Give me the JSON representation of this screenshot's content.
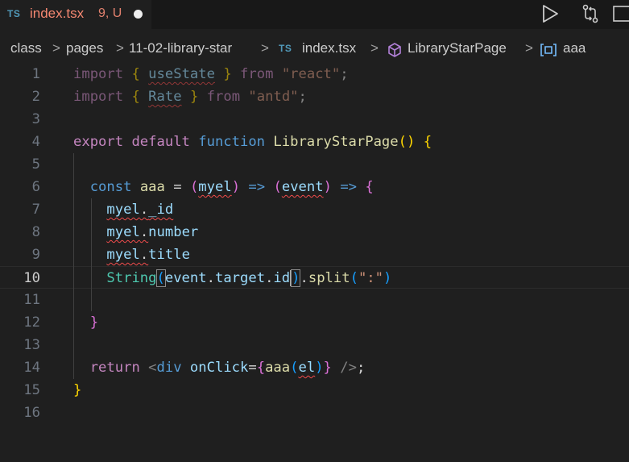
{
  "tab": {
    "lang_badge": "TS",
    "filename": "index.tsx",
    "status": "9, U"
  },
  "actions": {
    "run": "play-icon",
    "compare": "compare-changes-icon"
  },
  "breadcrumb": {
    "items": [
      "class",
      "pages",
      "11-02-library-star",
      "index.tsx",
      "LibraryStarPage",
      "aaa"
    ],
    "file_badge": "TS",
    "separator": ">"
  },
  "editor": {
    "current_line": 10,
    "lines": [
      {
        "n": "1",
        "tokens": [
          [
            "import",
            "kw"
          ],
          [
            " ",
            "pl"
          ],
          [
            "{",
            "b1"
          ],
          [
            " ",
            "pl"
          ],
          [
            "useState",
            "var sq"
          ],
          [
            " ",
            "pl"
          ],
          [
            "}",
            "b1"
          ],
          [
            " ",
            "pl"
          ],
          [
            "from",
            "kw"
          ],
          [
            " ",
            "pl"
          ],
          [
            "\"react\"",
            "str"
          ],
          [
            ";",
            "pl"
          ]
        ],
        "dim": true
      },
      {
        "n": "2",
        "tokens": [
          [
            "import",
            "kw"
          ],
          [
            " ",
            "pl"
          ],
          [
            "{",
            "b1"
          ],
          [
            " ",
            "pl"
          ],
          [
            "Rate",
            "var sq"
          ],
          [
            " ",
            "pl"
          ],
          [
            "}",
            "b1"
          ],
          [
            " ",
            "pl"
          ],
          [
            "from",
            "kw"
          ],
          [
            " ",
            "pl"
          ],
          [
            "\"antd\"",
            "str"
          ],
          [
            ";",
            "pl"
          ]
        ],
        "dim": true
      },
      {
        "n": "3",
        "tokens": []
      },
      {
        "n": "4",
        "tokens": [
          [
            "export",
            "kw"
          ],
          [
            " ",
            "pl"
          ],
          [
            "default",
            "kw"
          ],
          [
            " ",
            "pl"
          ],
          [
            "function",
            "kb"
          ],
          [
            " ",
            "pl"
          ],
          [
            "LibraryStarPage",
            "fn"
          ],
          [
            "()",
            "b1"
          ],
          [
            " ",
            "pl"
          ],
          [
            "{",
            "b1"
          ]
        ]
      },
      {
        "n": "5",
        "tokens": []
      },
      {
        "n": "6",
        "tokens": [
          [
            "  ",
            "pl"
          ],
          [
            "const",
            "kb"
          ],
          [
            " ",
            "pl"
          ],
          [
            "aaa",
            "fn"
          ],
          [
            " ",
            "pl"
          ],
          [
            "=",
            "pl"
          ],
          [
            " ",
            "pl"
          ],
          [
            "(",
            "b2"
          ],
          [
            "myel",
            "var sq"
          ],
          [
            ")",
            "b2"
          ],
          [
            " ",
            "pl"
          ],
          [
            "=>",
            "kb"
          ],
          [
            " ",
            "pl"
          ],
          [
            "(",
            "b2"
          ],
          [
            "event",
            "var sq"
          ],
          [
            ")",
            "b2"
          ],
          [
            " ",
            "pl"
          ],
          [
            "=>",
            "kb"
          ],
          [
            " ",
            "pl"
          ],
          [
            "{",
            "b2"
          ]
        ]
      },
      {
        "n": "7",
        "tokens": [
          [
            "    ",
            "pl"
          ],
          [
            "myel",
            "var sq"
          ],
          [
            ".",
            "pl sq"
          ],
          [
            "_id",
            "var sq"
          ]
        ]
      },
      {
        "n": "8",
        "tokens": [
          [
            "    ",
            "pl"
          ],
          [
            "myel",
            "var sq"
          ],
          [
            ".",
            "pl sq"
          ],
          [
            "number",
            "var"
          ]
        ]
      },
      {
        "n": "9",
        "tokens": [
          [
            "    ",
            "pl"
          ],
          [
            "myel",
            "var sq"
          ],
          [
            ".",
            "pl sq"
          ],
          [
            "title",
            "var"
          ]
        ]
      },
      {
        "n": "10",
        "tokens": [
          [
            "    ",
            "pl"
          ],
          [
            "String",
            "ty"
          ],
          [
            "(",
            "b3 bm"
          ],
          [
            "event",
            "var"
          ],
          [
            ".",
            "pl"
          ],
          [
            "target",
            "var"
          ],
          [
            ".",
            "pl"
          ],
          [
            "id",
            "var"
          ],
          [
            "",
            "cursor"
          ],
          [
            ")",
            "b3 bm"
          ],
          [
            ".",
            "pl"
          ],
          [
            "split",
            "fn"
          ],
          [
            "(",
            "b3"
          ],
          [
            "\":\"",
            "str"
          ],
          [
            ")",
            "b3"
          ]
        ]
      },
      {
        "n": "11",
        "tokens": []
      },
      {
        "n": "12",
        "tokens": [
          [
            "  ",
            "pl"
          ],
          [
            "}",
            "b2"
          ]
        ]
      },
      {
        "n": "13",
        "tokens": []
      },
      {
        "n": "14",
        "tokens": [
          [
            "  ",
            "pl"
          ],
          [
            "return",
            "kw"
          ],
          [
            " ",
            "pl"
          ],
          [
            "<",
            "gray"
          ],
          [
            "div",
            "kb"
          ],
          [
            " ",
            "pl"
          ],
          [
            "onClick",
            "var"
          ],
          [
            "=",
            "pl"
          ],
          [
            "{",
            "b2"
          ],
          [
            "aaa",
            "fn"
          ],
          [
            "(",
            "b3"
          ],
          [
            "el",
            "var sq"
          ],
          [
            ")",
            "b3"
          ],
          [
            "}",
            "b2"
          ],
          [
            " ",
            "pl"
          ],
          [
            "/>",
            "gray"
          ],
          [
            ";",
            "pl"
          ]
        ]
      },
      {
        "n": "15",
        "tokens": [
          [
            "}",
            "b1"
          ]
        ]
      },
      {
        "n": "16",
        "tokens": []
      }
    ]
  }
}
